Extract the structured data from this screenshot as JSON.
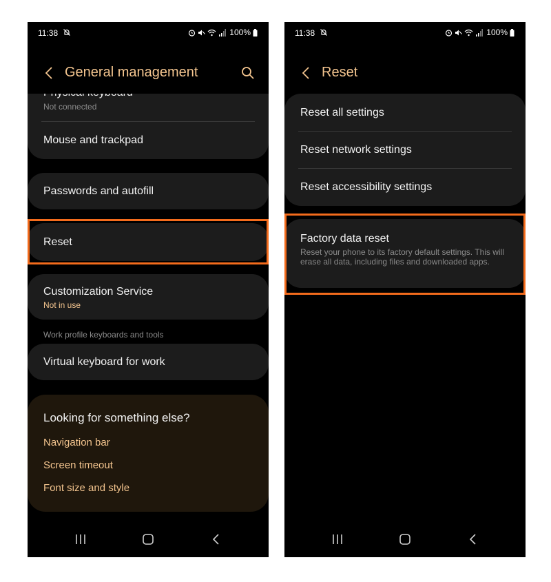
{
  "left_screen": {
    "status": {
      "time": "11:38",
      "battery": "100%"
    },
    "header": {
      "title": "General management"
    },
    "items": [
      {
        "title": "Physical keyboard",
        "subtitle": "Not connected"
      },
      {
        "title": "Mouse and trackpad"
      },
      {
        "title": "Passwords and autofill"
      },
      {
        "title": "Reset"
      },
      {
        "title": "Customization Service",
        "subtitle": "Not in use"
      }
    ],
    "section_label": "Work profile keyboards and tools",
    "work_item": {
      "title": "Virtual keyboard for work"
    },
    "suggestions": {
      "title": "Looking for something else?",
      "links": [
        "Navigation bar",
        "Screen timeout",
        "Font size and style"
      ]
    }
  },
  "right_screen": {
    "status": {
      "time": "11:38",
      "battery": "100%"
    },
    "header": {
      "title": "Reset"
    },
    "items": [
      {
        "title": "Reset all settings"
      },
      {
        "title": "Reset network settings"
      },
      {
        "title": "Reset accessibility settings"
      }
    ],
    "factory_reset": {
      "title": "Factory data reset",
      "description": "Reset your phone to its factory default settings. This will erase all data, including files and downloaded apps."
    }
  },
  "colors": {
    "accent": "#f4c58f",
    "highlight": "#f36b1c",
    "card": "#1c1c1c",
    "suggest_card": "#1f170c"
  }
}
